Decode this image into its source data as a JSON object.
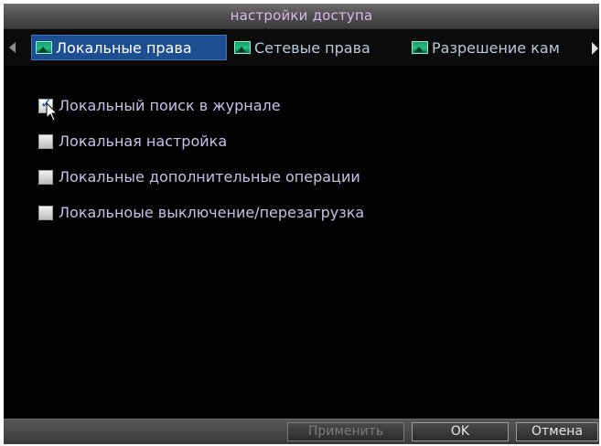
{
  "window": {
    "title": "настройки доступа"
  },
  "tabs": [
    {
      "label": "Локальные права",
      "active": true,
      "icon": "picture-icon"
    },
    {
      "label": "Сетевые права",
      "active": false,
      "icon": "picture-icon"
    },
    {
      "label": "Разрешение кам",
      "active": false,
      "icon": "picture-icon"
    }
  ],
  "permissions": [
    {
      "label": "Локальный поиск в журнале",
      "checked": true
    },
    {
      "label": "Локальная настройка",
      "checked": false
    },
    {
      "label": "Локальные дополнительные операции",
      "checked": false
    },
    {
      "label": "Локальноые выключение/перезагрузка",
      "checked": false
    }
  ],
  "buttons": {
    "apply": "Применить",
    "ok": "OK",
    "cancel": "Отмена"
  },
  "colors": {
    "active_tab": "#1d4e92",
    "label_text": "#c8c0e8",
    "title_text": "#d9b8e8"
  }
}
